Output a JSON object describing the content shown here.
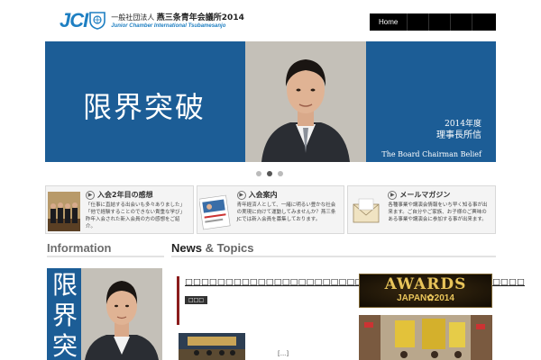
{
  "header": {
    "logo_mark": "JCI",
    "org_prefix": "一般社団法人",
    "org_name": "燕三条青年会議所2014",
    "org_english": "Junior Chamber International Tsubamesanjo"
  },
  "nav": {
    "items": [
      {
        "label": "Home"
      },
      {
        "label": ""
      },
      {
        "label": ""
      }
    ]
  },
  "hero": {
    "headline": "限界突破",
    "year": "2014年度",
    "title": "理事長所信",
    "english": "The Board Chairman Belief",
    "slide_index": 2,
    "slide_count": 3
  },
  "features": [
    {
      "title": "入会2年目の感想",
      "body": "「仕事に直結する出会いも多々ありました」「他で経験することのできない貴重な学び」昨年入会された新入会員の方の感想をご紹介。"
    },
    {
      "title": "入会案内",
      "body": "青年経済人として、一緒に明るい豊かな社会の実現に向けて運動してみませんか？燕三条JCでは新入会員を募集しております。"
    },
    {
      "title": "メールマガジン",
      "body": "各種事業や講演会情報をいち早く知る事が出来ます。ご自分やご家族、お子様のご興味のある事業や講演会に参加する事が出来ます。"
    }
  ],
  "info": {
    "heading": "Information",
    "image_text": "限界突"
  },
  "news": {
    "heading_main": "News",
    "heading_rest": " & Topics",
    "items": [
      {
        "title": "□□□□□□□□□□□□□□□□□□□□□□□□□□□□□□□□□□□□□□□□□□",
        "tag": "□□□"
      }
    ],
    "more_label": "[...]"
  },
  "banners": {
    "awards_top": "AWARDS",
    "awards_bottom": "JAPAN✿2014"
  },
  "colors": {
    "brand_blue": "#1e7fc2",
    "hero_blue": "#1c5d96",
    "news_accent": "#8b1d1d"
  }
}
